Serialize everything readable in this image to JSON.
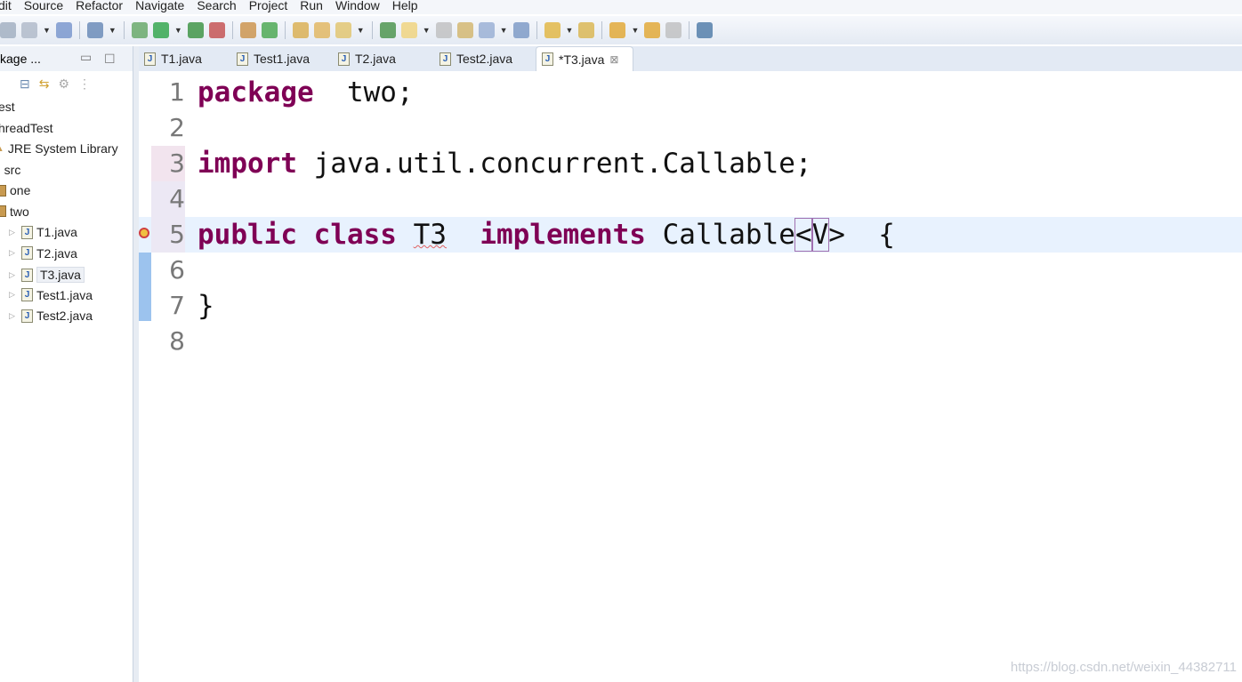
{
  "menu": [
    "dit",
    "Source",
    "Refactor",
    "Navigate",
    "Search",
    "Project",
    "Run",
    "Window",
    "Help"
  ],
  "explorer": {
    "title": "kage ...",
    "items": [
      {
        "label": "est",
        "indent": 0,
        "icon": "project-icon"
      },
      {
        "label": "hreadTest",
        "indent": 0,
        "icon": "project-icon"
      },
      {
        "label": "JRE System Library",
        "indent": 1,
        "icon": "library-icon"
      },
      {
        "label": "src",
        "indent": 1,
        "icon": "source-folder-icon"
      },
      {
        "label": "one",
        "indent": 2,
        "icon": "package-icon"
      },
      {
        "label": "two",
        "indent": 2,
        "icon": "package-icon"
      },
      {
        "label": "T1.java",
        "indent": 3,
        "icon": "java-file-icon"
      },
      {
        "label": "T2.java",
        "indent": 3,
        "icon": "java-file-icon"
      },
      {
        "label": "T3.java",
        "indent": 3,
        "icon": "java-file-icon",
        "selected": true
      },
      {
        "label": "Test1.java",
        "indent": 3,
        "icon": "java-file-icon"
      },
      {
        "label": "Test2.java",
        "indent": 3,
        "icon": "java-file-icon"
      }
    ]
  },
  "tabs": [
    {
      "label": "T1.java"
    },
    {
      "label": "Test1.java"
    },
    {
      "label": "T2.java"
    },
    {
      "label": "Test2.java"
    },
    {
      "label": "*T3.java",
      "active": true,
      "close": "⊠"
    }
  ],
  "editor": {
    "lines": [
      {
        "n": "1",
        "parts": [
          [
            "kw",
            "package"
          ],
          [
            "",
            "  two;"
          ]
        ]
      },
      {
        "n": "2",
        "parts": []
      },
      {
        "n": "3",
        "parts": [
          [
            "kw",
            "import"
          ],
          [
            "",
            " java.util.concurrent.Callable;"
          ]
        ]
      },
      {
        "n": "4",
        "parts": []
      },
      {
        "n": "5",
        "parts": [
          [
            "kw",
            "public"
          ],
          [
            "",
            " "
          ],
          [
            "kw",
            "class"
          ],
          [
            "",
            " "
          ],
          [
            "err",
            "T3"
          ],
          [
            "",
            "  "
          ],
          [
            "kw",
            "implements"
          ],
          [
            "",
            " Callable"
          ],
          [
            "box",
            "<"
          ],
          [
            "box",
            "V"
          ],
          [
            "",
            ">"
          ],
          [
            "",
            "  {"
          ]
        ]
      },
      {
        "n": "6",
        "parts": []
      },
      {
        "n": "7",
        "parts": [
          [
            "",
            "}"
          ]
        ]
      },
      {
        "n": "8",
        "parts": []
      }
    ]
  },
  "watermark": "https://blog.csdn.net/weixin_44382711",
  "colors": {
    "keyword": "#7f0055",
    "current_line": "#e8f2fe",
    "overview_ruler": "#9cc3ee"
  }
}
